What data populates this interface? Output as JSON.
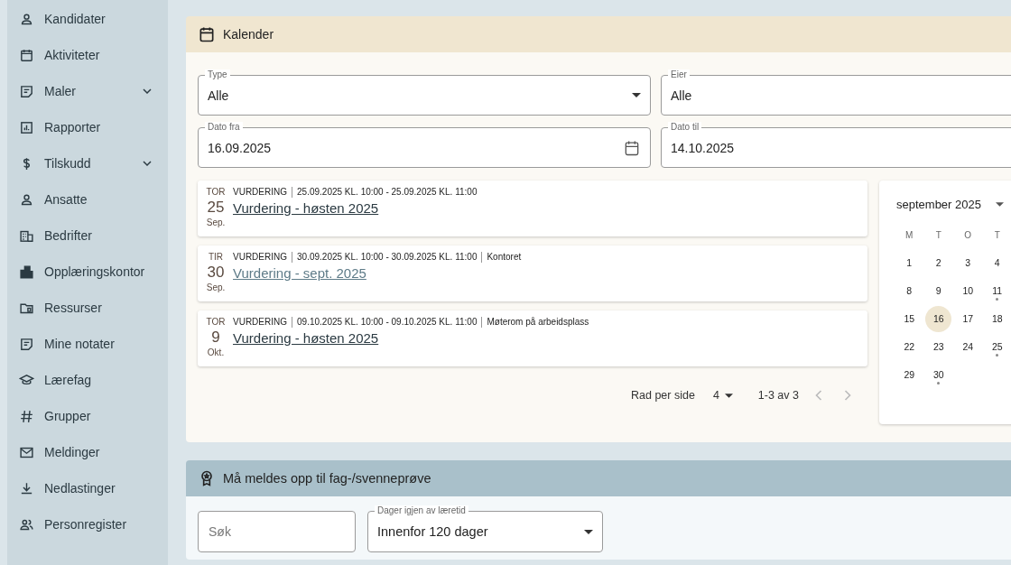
{
  "sidebar": {
    "items": [
      {
        "label": "Kandidater",
        "kind": "link"
      },
      {
        "label": "Aktiviteter",
        "kind": "link"
      },
      {
        "label": "Maler",
        "kind": "group",
        "expanded": false
      },
      {
        "label": "Rapporter",
        "kind": "link"
      },
      {
        "label": "Tilskudd",
        "kind": "group",
        "expanded": false
      },
      {
        "label": "Ansatte",
        "kind": "link"
      },
      {
        "label": "Bedrifter",
        "kind": "link"
      },
      {
        "label": "Opplæringskontor",
        "kind": "link"
      },
      {
        "label": "Ressurser",
        "kind": "link"
      },
      {
        "label": "Mine notater",
        "kind": "link"
      },
      {
        "label": "Lærefag",
        "kind": "link"
      },
      {
        "label": "Grupper",
        "kind": "link"
      },
      {
        "label": "Meldinger",
        "kind": "link"
      },
      {
        "label": "Nedlastinger",
        "kind": "link"
      },
      {
        "label": "Personregister",
        "kind": "link"
      }
    ]
  },
  "calendar_panel": {
    "title": "Kalender",
    "filters": [
      {
        "label": "Type",
        "value": "Alle",
        "kind": "select"
      },
      {
        "label": "Eier",
        "value": "Alle",
        "kind": "plain"
      },
      {
        "label": "Dato fra",
        "value": "16.09.2025",
        "kind": "date"
      },
      {
        "label": "Dato til",
        "value": "14.10.2025",
        "kind": "plain"
      }
    ],
    "events": [
      {
        "weekday": "TOR",
        "day": "25",
        "month": "Sep.",
        "type": "VURDERING",
        "time": "25.09.2025 KL. 10:00 - 25.09.2025 KL. 11:00",
        "title": "Vurdering - høsten 2025",
        "hovered": false
      },
      {
        "weekday": "TIR",
        "day": "30",
        "month": "Sep.",
        "type": "VURDERING",
        "time": "30.09.2025 KL. 10:00 - 30.09.2025 KL. 11:00",
        "location": "Kontoret",
        "title": "Vurdering - sept. 2025",
        "hovered": true
      },
      {
        "weekday": "TOR",
        "day": "9",
        "month": "Okt.",
        "type": "VURDERING",
        "time": "09.10.2025 KL. 10:00 - 09.10.2025 KL. 11:00",
        "location": "Møterom på arbeidsplass",
        "title": "Vurdering - høsten 2025",
        "hovered": false
      }
    ],
    "pagination": {
      "rows_label": "Rad per side",
      "rows_value": "4",
      "range": "1-3 av 3",
      "prev_disabled": true,
      "next_disabled": true
    },
    "month_view": {
      "title": "september 2025",
      "weekdays": [
        "M",
        "T",
        "O",
        "T"
      ],
      "weeks": [
        [
          {
            "day": "1",
            "today": false,
            "has_event": false
          },
          {
            "day": "2",
            "today": false,
            "has_event": false
          },
          {
            "day": "3",
            "today": false,
            "has_event": false
          },
          {
            "day": "4",
            "today": false,
            "has_event": false
          }
        ],
        [
          {
            "day": "8",
            "today": false,
            "has_event": false
          },
          {
            "day": "9",
            "today": false,
            "has_event": false
          },
          {
            "day": "10",
            "today": false,
            "has_event": false
          },
          {
            "day": "11",
            "today": false,
            "has_event": true
          }
        ],
        [
          {
            "day": "15",
            "today": false,
            "has_event": false
          },
          {
            "day": "16",
            "today": true,
            "has_event": false
          },
          {
            "day": "17",
            "today": false,
            "has_event": false
          },
          {
            "day": "18",
            "today": false,
            "has_event": false
          }
        ],
        [
          {
            "day": "22",
            "today": false,
            "has_event": false
          },
          {
            "day": "23",
            "today": false,
            "has_event": false
          },
          {
            "day": "24",
            "today": false,
            "has_event": false
          },
          {
            "day": "25",
            "today": false,
            "has_event": true
          }
        ],
        [
          {
            "day": "29",
            "today": false,
            "has_event": false
          },
          {
            "day": "30",
            "today": false,
            "has_event": true
          }
        ]
      ]
    }
  },
  "exam_panel": {
    "title": "Må meldes opp til fag-/svenneprøve",
    "search": {
      "placeholder": "Søk"
    },
    "days_filter": {
      "label": "Dager igjen av læretid",
      "value": "Innenfor 120 dager"
    }
  }
}
